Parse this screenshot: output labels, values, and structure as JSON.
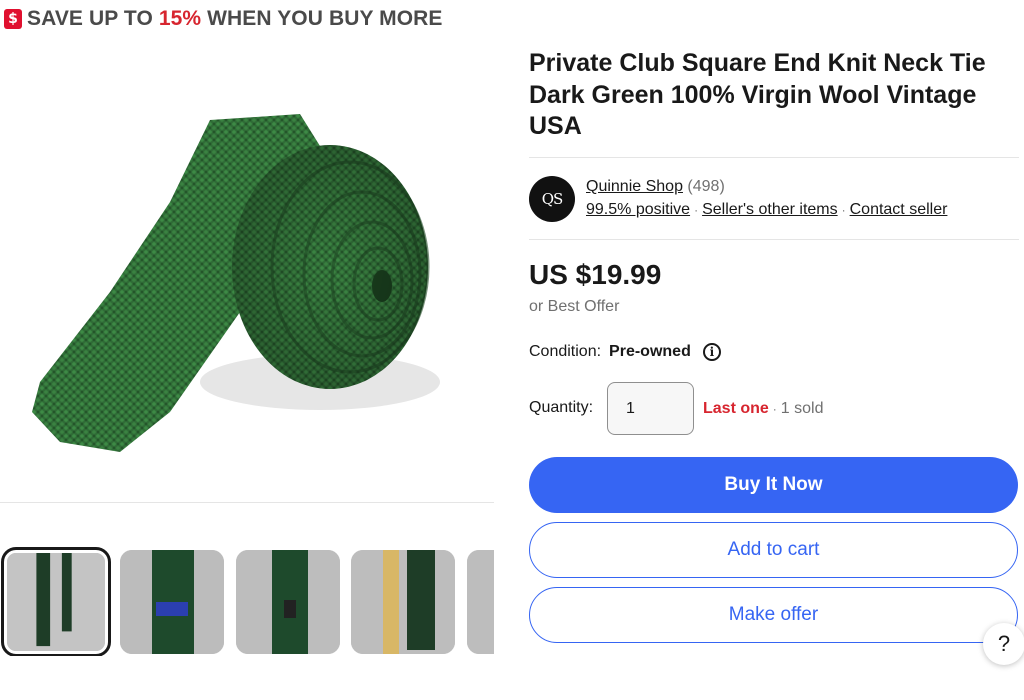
{
  "promo": {
    "icon": "dollar-tag-icon",
    "prefix": "SAVE UP TO ",
    "percent": "15%",
    "suffix": " WHEN YOU BUY MORE"
  },
  "listing": {
    "title": "Private Club Square End Knit Neck Tie Dark Green 100% Virgin Wool Vintage USA"
  },
  "seller": {
    "avatar_text": "QS",
    "name": "Quinnie Shop",
    "feedback_count": "(498)",
    "positive": "99.5% positive",
    "other_items": "Seller's other items",
    "contact": "Contact seller"
  },
  "price": {
    "amount": "US $19.99",
    "best_offer": "or Best Offer"
  },
  "condition": {
    "label": "Condition:",
    "value": "Pre-owned",
    "info_icon": "i"
  },
  "quantity": {
    "label": "Quantity:",
    "value": "1",
    "last_one": "Last one",
    "sold": "1 sold"
  },
  "buttons": {
    "buy_now": "Buy It Now",
    "add_to_cart": "Add to cart",
    "make_offer": "Make offer"
  },
  "help": "?",
  "colors": {
    "accent": "#3665f3",
    "promo_red": "#d7252f",
    "tie_green": "#2f6b36"
  }
}
